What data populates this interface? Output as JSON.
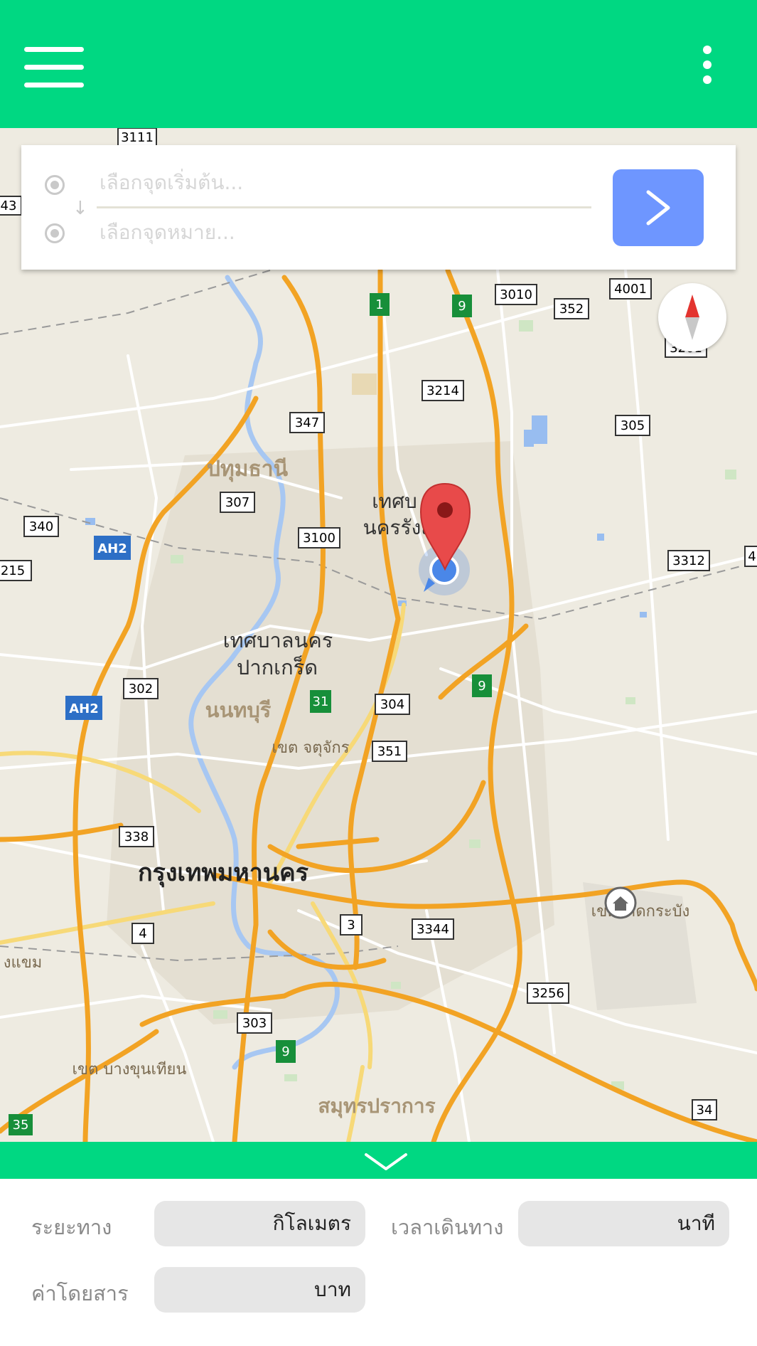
{
  "route": {
    "origin_placeholder": "เลือกจุดเริ่มต้น...",
    "destination_placeholder": "เลือกจุดหมาย...",
    "go_icon": "chevron-right-icon"
  },
  "map": {
    "city_labels": {
      "bangkok": "กรุงเทพมหานคร",
      "pathum_thani": "ปทุมธานี",
      "pak_kret_1": "เทศบาลนคร",
      "pak_kret_2": "ปากเกร็ด",
      "nonthaburi": "นนทบุรี",
      "chatuchak": "เขต จตุจักร",
      "rangsit_1": "เทศบ",
      "rangsit_2": "นครรังส",
      "lat_krabang": "เขตลาดกระบัง",
      "bang_khun_thian": "เขต บางขุนเทียน",
      "samut_prakan": "สมุทรปราการ",
      "edge_left": "งแขม"
    },
    "road_shields": [
      "3111",
      "43",
      "1",
      "9",
      "3010",
      "352",
      "4001",
      "3261",
      "3214",
      "347",
      "305",
      "307",
      "340",
      "AH2",
      "3100",
      "3312",
      "215",
      "302",
      "AH2",
      "31",
      "304",
      "9",
      "351",
      "338",
      "4",
      "3",
      "3344",
      "3256",
      "303",
      "9",
      "34",
      "35",
      "4"
    ],
    "marker_icon": "map-pin-icon",
    "location_icon": "current-location-icon",
    "home_icon": "home-icon"
  },
  "panel": {
    "distance_label": "ระยะทาง",
    "distance_unit": "กิโลเมตร",
    "duration_label": "เวลาเดินทาง",
    "duration_unit": "นาที",
    "fare_label": "ค่าโดยสาร",
    "fare_unit": "บาท"
  },
  "colors": {
    "app_bar": "#00d882",
    "go_button": "#6e96ff",
    "highway": "#f2a324",
    "field_bg": "#e6e6e6"
  }
}
